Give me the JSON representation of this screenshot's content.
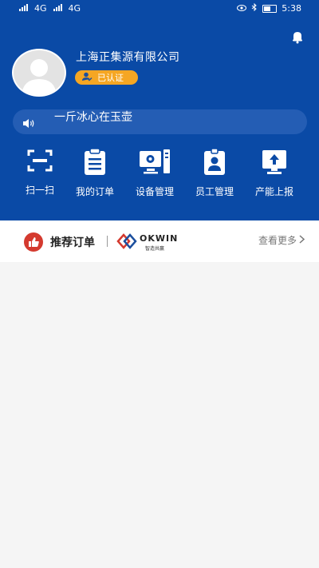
{
  "status_bar": {
    "left_label_1": "4G",
    "left_label_2": "4G",
    "time": "5:38"
  },
  "profile": {
    "company_name": "上海正集源有限公司",
    "cert_label": "已认证"
  },
  "notice": {
    "text": "一斤冰心在玉壶"
  },
  "nav": {
    "items": [
      {
        "label": "扫一扫",
        "icon": "scan-icon"
      },
      {
        "label": "我的订单",
        "icon": "order-icon"
      },
      {
        "label": "设备管理",
        "icon": "device-icon"
      },
      {
        "label": "员工管理",
        "icon": "employee-icon"
      },
      {
        "label": "产能上报",
        "icon": "upload-icon"
      }
    ]
  },
  "section": {
    "title": "推荐订单",
    "logo_text": "OKWIN",
    "logo_sub": "智造共赢",
    "more_label": "查看更多"
  },
  "colors": {
    "primary": "#0a4aa6",
    "accent": "#f5a623",
    "section_icon": "#d43a2f"
  }
}
